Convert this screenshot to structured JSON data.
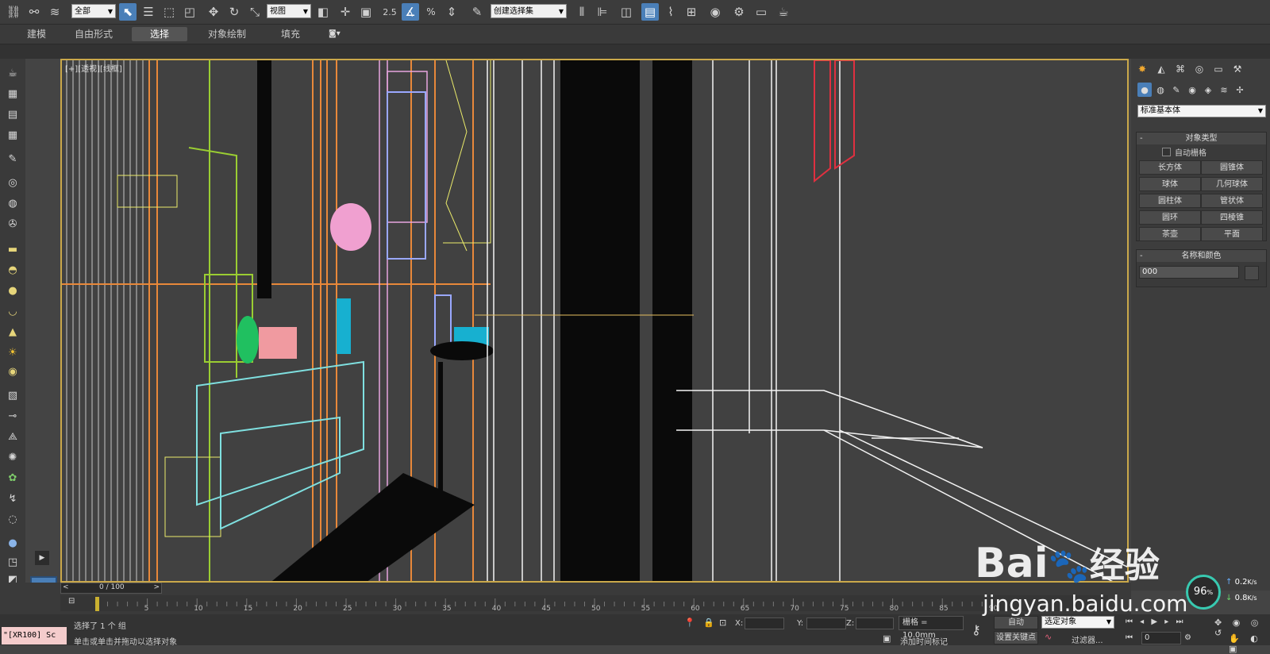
{
  "toolbar": {
    "filter_select": "全部",
    "ref_coord_select": "视图",
    "snap_angle": "2.5",
    "snap_percent": "%",
    "named_selection_select": "创建选择集",
    "icons": [
      "link-icon",
      "unlink-icon",
      "bind-spacewarp-icon",
      "select-object-icon",
      "select-by-name-icon",
      "rect-selection-icon",
      "window-crossing-icon",
      "move-icon",
      "rotate-icon",
      "scale-icon",
      "pivot-icon",
      "snap-toggle-icon",
      "angle-snap-icon",
      "percent-snap-icon",
      "spinner-snap-icon",
      "edit-named-selection-icon",
      "mirror-icon",
      "align-icon",
      "layer-manager-icon",
      "ribbon-icon",
      "curve-editor-icon",
      "schematic-icon",
      "material-editor-icon",
      "render-setup-icon",
      "rendered-frame-icon",
      "render-icon"
    ]
  },
  "ribbon": {
    "tabs": [
      {
        "label": "建模",
        "active": false
      },
      {
        "label": "自由形式",
        "active": false
      },
      {
        "label": "选择",
        "active": true
      },
      {
        "label": "对象绘制",
        "active": false
      },
      {
        "label": "填充",
        "active": false
      }
    ]
  },
  "viewport": {
    "label": "[+][透视][线框]",
    "border_color": "#caa84a"
  },
  "command_panel": {
    "category_select": "标准基本体",
    "object_type_title": "对象类型",
    "autogrid_label": "自动栅格",
    "object_buttons": [
      "长方体",
      "圆锥体",
      "球体",
      "几何球体",
      "圆柱体",
      "管状体",
      "圆环",
      "四棱锥",
      "茶壶",
      "平面"
    ],
    "name_color_title": "名称和颜色",
    "object_name": "000"
  },
  "timeline": {
    "frame_counter": "0 / 100",
    "ticks": [
      "0",
      "5",
      "10",
      "15",
      "20",
      "25",
      "30",
      "35",
      "40",
      "45",
      "50",
      "55",
      "60",
      "65",
      "70",
      "75",
      "80",
      "85",
      "90"
    ]
  },
  "status": {
    "maxscript_text": "\"[XR100] Sc",
    "selection_info": "选择了 1 个 组",
    "prompt": "单击或单击并拖动以选择对象",
    "x_label": "X:",
    "y_label": "Y:",
    "z_label": "Z:",
    "grid_label": "栅格 = 10.0mm",
    "auto_key": "自动",
    "set_key": "设置关键点",
    "key_filter_select": "选定对象",
    "filters": "过滤器...",
    "add_time_tag": "添加时间标记",
    "frame_value": "0",
    "fps_percent": "96",
    "rate_up": "0.2",
    "rate_down": "0.8"
  },
  "watermark": {
    "brand": "Bai",
    "brand2": "经验",
    "url": "jingyan.baidu.com"
  }
}
